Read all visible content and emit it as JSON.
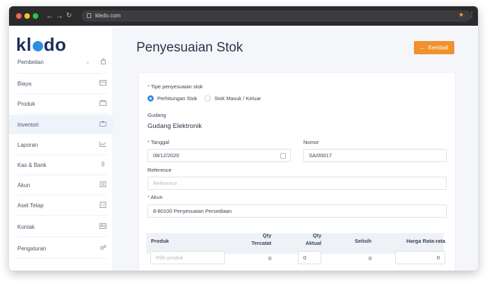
{
  "browser": {
    "url": "kledo.com",
    "back_icon": "arrow-left",
    "forward_icon": "arrow-right",
    "reload_icon": "reload",
    "star_icon": "star",
    "menu_icon": "more-vertical"
  },
  "sidebar": {
    "logo": "kledo",
    "items": [
      {
        "label": "Pembelian",
        "icon": "bag-icon",
        "active": false
      },
      {
        "label": "Biaya",
        "icon": "card-icon",
        "active": false
      },
      {
        "label": "Produk",
        "icon": "box-icon",
        "active": false
      },
      {
        "label": "Inventori",
        "icon": "warehouse-icon",
        "active": true
      },
      {
        "label": "Laporan",
        "icon": "chart-icon",
        "active": false
      },
      {
        "label": "Kas & Bank",
        "icon": "dollar-icon",
        "active": false
      },
      {
        "label": "Akun",
        "icon": "book-icon",
        "active": false
      },
      {
        "label": "Aset Tetap",
        "icon": "building-icon",
        "active": false
      },
      {
        "label": "Kontak",
        "icon": "contact-icon",
        "active": false
      },
      {
        "label": "Pengaturan",
        "icon": "gear-icon",
        "active": false
      }
    ]
  },
  "header": {
    "title": "Penyesuaian Stok",
    "back_label": "Kembali"
  },
  "form": {
    "tipe_label": "Tipe penyesuaian stok",
    "tipe_options": [
      "Perhitungan Stok",
      "Stok Masuk / Keluar"
    ],
    "tipe_selected": "Perhitungan Stok",
    "gudang_label": "Gudang",
    "gudang_value": "Gudang Elektronik",
    "tanggal_label": "Tanggal",
    "tanggal_value": "08/12/2020",
    "nomor_label": "Nomor",
    "nomor_value": "SA/00017",
    "reference_label": "Reference",
    "reference_placeholder": "Reference",
    "akun_label": "Akun",
    "akun_value": "8-80100 Penyesuaian Persediaan"
  },
  "table": {
    "headers": {
      "produk": "Produk",
      "qty_tercatat": [
        "Qty",
        "Tercatat"
      ],
      "qty_aktual": [
        "Qty",
        "Aktual"
      ],
      "selisih": "Selisih",
      "harga": "Harga Rata-rata"
    },
    "row": {
      "produk_placeholder": "Pilih produk",
      "qty_tercatat": "0",
      "qty_aktual": "0",
      "selisih": "0",
      "harga": "0"
    }
  },
  "colors": {
    "accent": "#2f8de4",
    "button": "#f0912e",
    "required": "#e0453a",
    "active_bg": "#eef4fc"
  }
}
